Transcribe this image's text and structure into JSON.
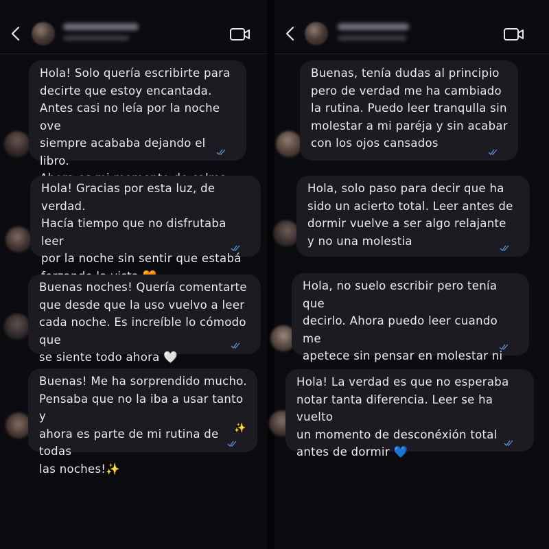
{
  "left_chat": {
    "messages": [
      {
        "text": "Hola! Solo quería escribirte para\ndecirte que estoy encantada.\nAntes casi no leía por la noche ove\nsiempre acababa dejando el libro.\nAhora es mi momento de calma 💛"
      },
      {
        "text": "Hola! Gracias por esta luz, de verdad.\nHacía tiempo que no disfrutaba leer\npor la noche sin sentir que estabá\nforzando la vista 🧡"
      },
      {
        "text": "Buenas noches! Quería comentarte\nque desde que la uso vuelvo a leer\ncada noche. Es increíble lo cómodo que\nse siente todo ahora 🤍"
      },
      {
        "text": "Buenas! Me ha sorprendido mucho.\nPensaba que no la iba a usar tanto y\nahora es parte de mi rutina de todas\nlas noches!✨",
        "sparkle": "✨"
      }
    ]
  },
  "right_chat": {
    "messages": [
      {
        "text": "Buenas, tenía dudas al principio\npero de verdad me ha cambiado\nla rutina. Puedo leer tranqulla sin\nmolestar a mi paréja y sin acabar\ncon los ojos cansados"
      },
      {
        "text": "Hola, solo paso para decir que ha\nsido un acierto total. Leer antes de\ndormir vuelve a ser algo relajante\ny no una molestia"
      },
      {
        "text": "Hola, no suelo escribir pero tenía que\ndecirlo. Ahora puedo leer cuando me\napetece sin pensar en molestar ni en\nel cansancio de ojos"
      },
      {
        "text": "Hola! La verdad es que no esperaba\nnotar tanta diferencia. Leer se ha vuelto\nun momento de desconéxión total\nantes de dormir 💙"
      }
    ]
  },
  "icons": {
    "back": "chevron-left-icon",
    "video": "video-camera-icon",
    "read_receipt": "double-check-icon"
  },
  "colors": {
    "background": "#0c0c10",
    "bubble": "#1b1b21",
    "text": "#ecebef",
    "read_check": "#5c8fd6"
  }
}
